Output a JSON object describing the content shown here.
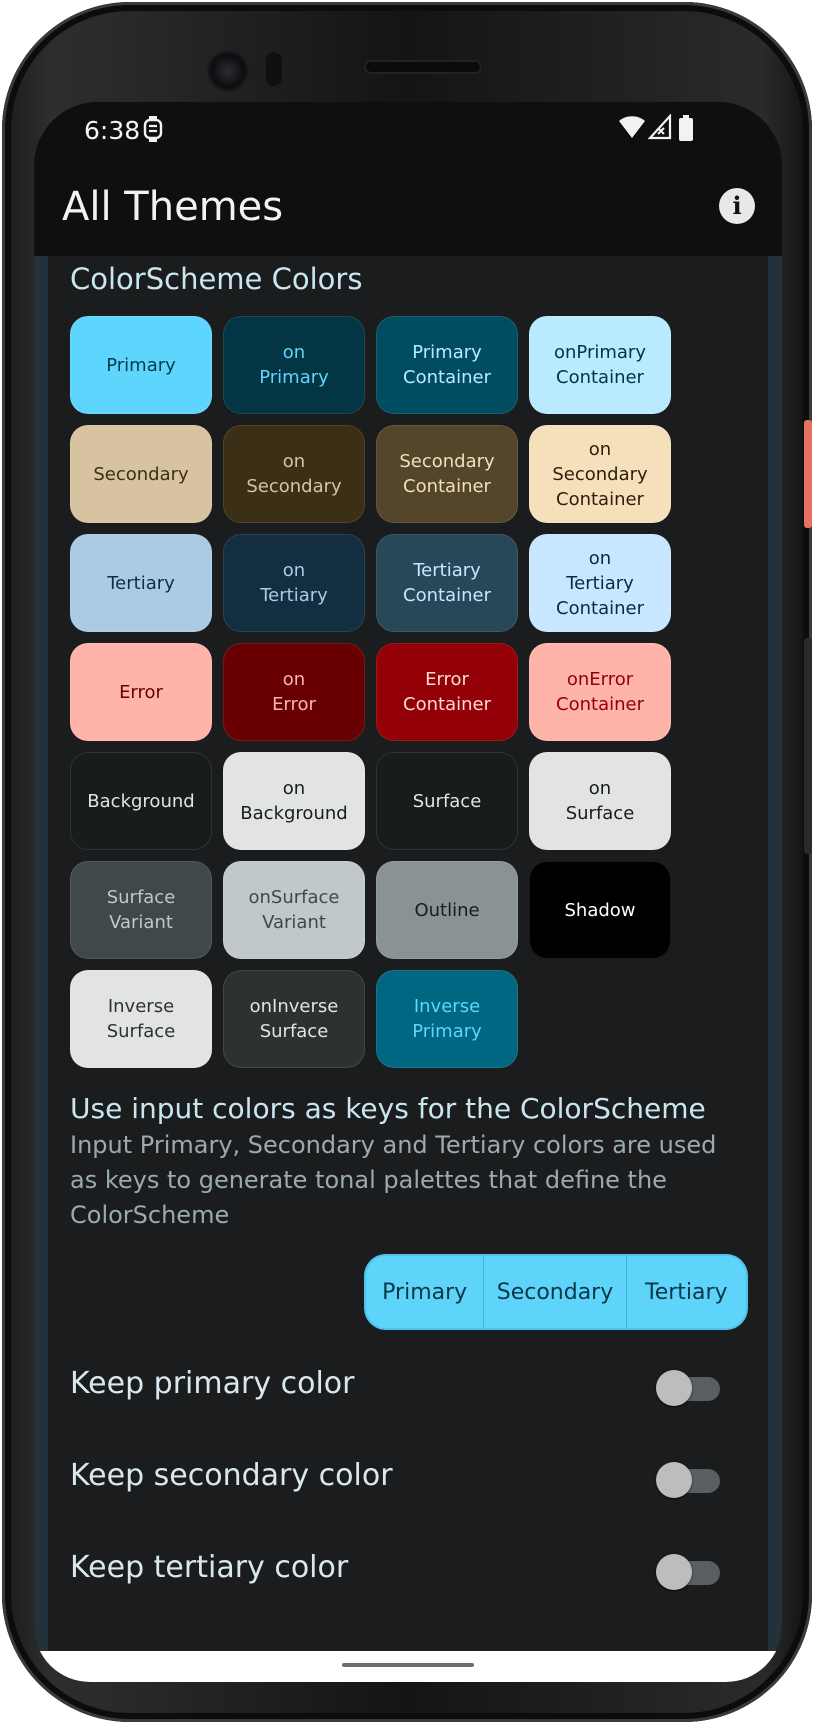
{
  "status": {
    "time": "6:38"
  },
  "app": {
    "title": "All Themes",
    "info_label": "i"
  },
  "colorscheme": {
    "title": "ColorScheme Colors",
    "chips": [
      {
        "label": "Primary",
        "bg": "#5dd5fc",
        "fg": "#073a4a"
      },
      {
        "label": "on\nPrimary",
        "bg": "#033545",
        "fg": "#5dd5fc"
      },
      {
        "label": "Primary\nContainer",
        "bg": "#004d62",
        "fg": "#b9eaff"
      },
      {
        "label": "onPrimary\nContainer",
        "bg": "#b9eaff",
        "fg": "#003545"
      },
      {
        "label": "Secondary",
        "bg": "#d8c3a0",
        "fg": "#3b2f15"
      },
      {
        "label": "on\nSecondary",
        "bg": "#3b2f15",
        "fg": "#d8c3a0"
      },
      {
        "label": "Secondary\nContainer",
        "bg": "#53462a",
        "fg": "#f5dfbb"
      },
      {
        "label": "on\nSecondary\nContainer",
        "bg": "#f6dfbb",
        "fg": "#2a1f07"
      },
      {
        "label": "Tertiary",
        "bg": "#a9cbe3",
        "fg": "#0e2f43"
      },
      {
        "label": "on\nTertiary",
        "bg": "#122e40",
        "fg": "#a9cbe3"
      },
      {
        "label": "Tertiary\nContainer",
        "bg": "#284759",
        "fg": "#c8e6ff"
      },
      {
        "label": "on\nTertiary\nContainer",
        "bg": "#c8e6ff",
        "fg": "#0b2a3b"
      },
      {
        "label": "Error",
        "bg": "#ffb4a9",
        "fg": "#680003"
      },
      {
        "label": "on\nError",
        "bg": "#680003",
        "fg": "#ffb4a9"
      },
      {
        "label": "Error\nContainer",
        "bg": "#930006",
        "fg": "#ffdad4"
      },
      {
        "label": "onError\nContainer",
        "bg": "#ffb4a9",
        "fg": "#930006"
      },
      {
        "label": "Background",
        "bg": "#191c1d",
        "fg": "#e1e3e4"
      },
      {
        "label": "on\nBackground",
        "bg": "#e1e3e4",
        "fg": "#191c1d"
      },
      {
        "label": "Surface",
        "bg": "#191c1d",
        "fg": "#e1e3e4"
      },
      {
        "label": "on\nSurface",
        "bg": "#e1e3e4",
        "fg": "#191c1d"
      },
      {
        "label": "Surface\nVariant",
        "bg": "#40484c",
        "fg": "#c0c8cc"
      },
      {
        "label": "onSurface\nVariant",
        "bg": "#c0c8cc",
        "fg": "#40484c"
      },
      {
        "label": "Outline",
        "bg": "#8a9296",
        "fg": "#191c1d"
      },
      {
        "label": "Shadow",
        "bg": "#000000",
        "fg": "#ffffff"
      },
      {
        "label": "Inverse\nSurface",
        "bg": "#e1e3e4",
        "fg": "#2e3132"
      },
      {
        "label": "onInverse\nSurface",
        "bg": "#2e3132",
        "fg": "#e1e3e4"
      },
      {
        "label": "Inverse\nPrimary",
        "bg": "#006782",
        "fg": "#5dd5fc"
      }
    ]
  },
  "keys": {
    "title": "Use input colors as keys for the ColorScheme",
    "description": "Input Primary, Secondary and Tertiary colors are used as keys to generate tonal palettes that define the ColorScheme",
    "segments": [
      "Primary",
      "Secondary",
      "Tertiary"
    ]
  },
  "toggles": [
    {
      "label": "Keep primary color",
      "on": false
    },
    {
      "label": "Keep secondary color",
      "on": false
    },
    {
      "label": "Keep tertiary color",
      "on": false
    }
  ]
}
